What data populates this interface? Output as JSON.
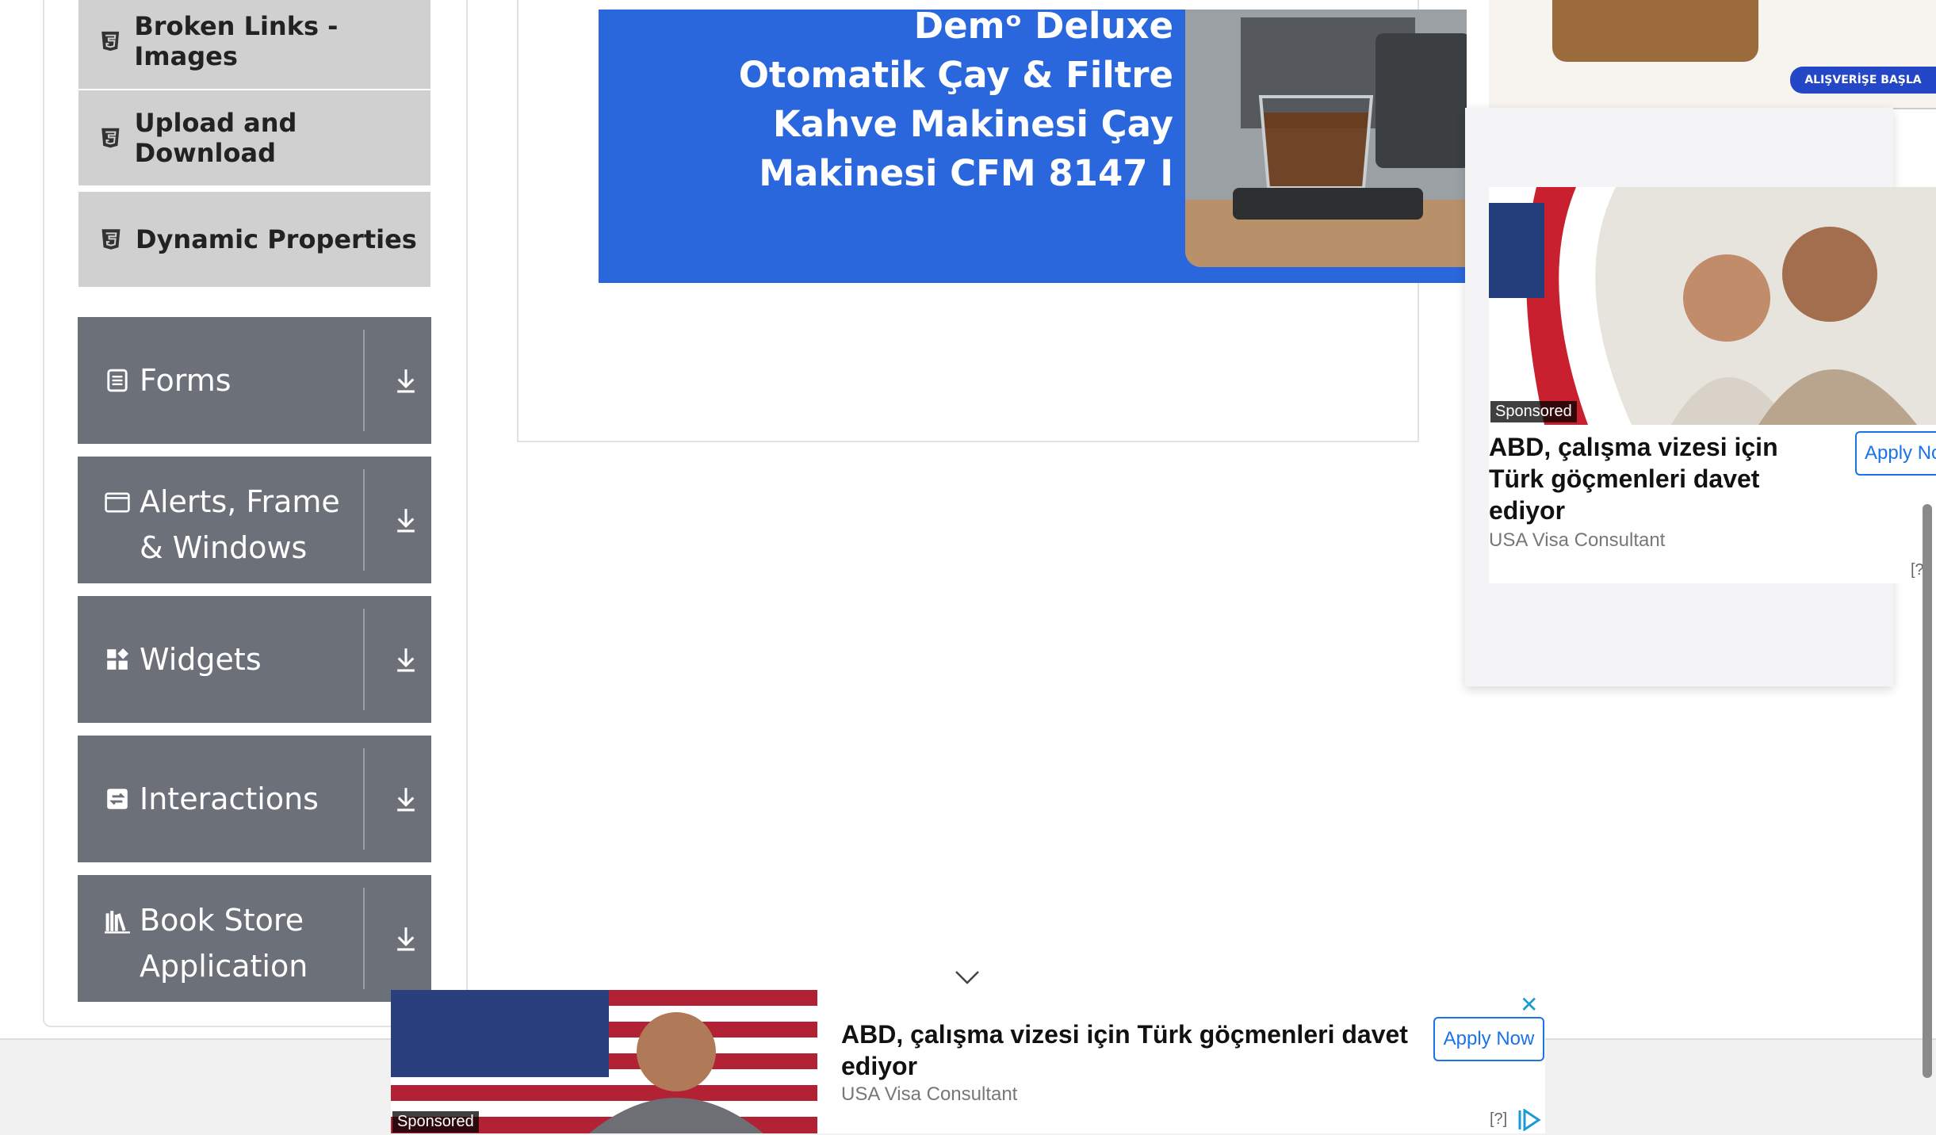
{
  "sidebar": {
    "sub_items": [
      {
        "label": "Broken Links - Images"
      },
      {
        "label": "Upload and Download"
      },
      {
        "label": "Dynamic Properties"
      }
    ],
    "groups": [
      {
        "label": "Forms",
        "icon": "forms-icon"
      },
      {
        "label": "Alerts, Frame & Windows",
        "icon": "window-icon"
      },
      {
        "label": "Widgets",
        "icon": "widgets-icon"
      },
      {
        "label": "Interactions",
        "icon": "interactions-icon"
      },
      {
        "label": "Book Store Application",
        "icon": "bookstore-icon"
      }
    ]
  },
  "banner": {
    "lines": [
      "Demᵒ Deluxe",
      "Otomatik Çay & Filtre",
      "Kahve Makinesi Çay",
      "Makinesi CFM 8147 I"
    ]
  },
  "right_ad_top": {
    "cta": "ALIŞVERİŞE BAŞLA"
  },
  "right_ad": {
    "sponsored": "Sponsored",
    "title": "ABD, çalışma vizesi için Türk göçmenleri davet ediyor",
    "source": "USA Visa Consultant",
    "button": "Apply No",
    "info": "[?]"
  },
  "bottom_ad": {
    "sponsored": "Sponsored",
    "title": "ABD, çalışma vizesi için Türk göçmenleri davet ediyor",
    "source": "USA Visa Consultant",
    "button": "Apply Now",
    "info": "[?]",
    "close": "✕"
  },
  "colors": {
    "group_bg": "#6b7079",
    "sub_bg": "#d0d0d0",
    "banner_bg": "#2a66dc",
    "link_blue": "#1a73e8"
  }
}
